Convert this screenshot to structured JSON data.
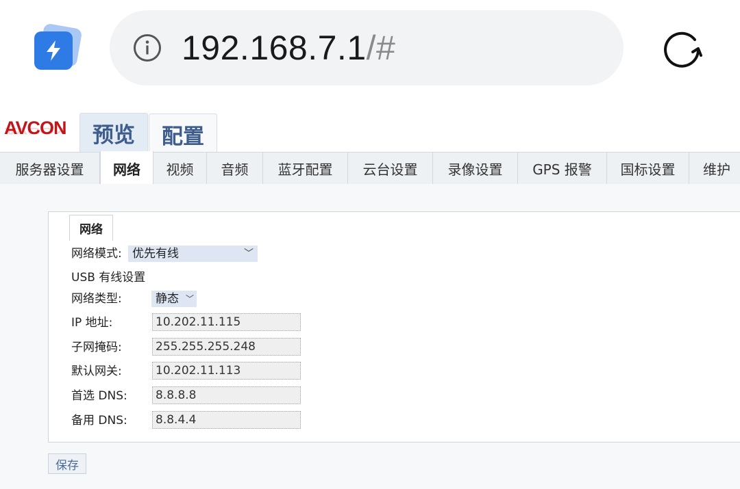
{
  "browser": {
    "url_main": "192.168.7.1",
    "url_suffix": "/#"
  },
  "logo": {
    "text": "AVCON"
  },
  "main_tabs": [
    {
      "label": "预览"
    },
    {
      "label": "配置"
    }
  ],
  "sub_tabs": [
    {
      "label": "服务器设置"
    },
    {
      "label": "网络"
    },
    {
      "label": "视频"
    },
    {
      "label": "音频"
    },
    {
      "label": "蓝牙配置"
    },
    {
      "label": "云台设置"
    },
    {
      "label": "录像设置"
    },
    {
      "label": "GPS 报警"
    },
    {
      "label": "国标设置"
    },
    {
      "label": "维护"
    }
  ],
  "panel": {
    "tab_label": "网络",
    "network_mode": {
      "label": "网络模式:",
      "value": "优先有线"
    },
    "section_title": "USB 有线设置",
    "network_type": {
      "label": "网络类型:",
      "value": "静态"
    },
    "fields": [
      {
        "label": "IP 地址:",
        "value": "10.202.11.115"
      },
      {
        "label": "子网掩码:",
        "value": "255.255.255.248"
      },
      {
        "label": "默认网关:",
        "value": "10.202.11.113"
      },
      {
        "label": "首选 DNS:",
        "value": "8.8.8.8"
      },
      {
        "label": "备用 DNS:",
        "value": "8.8.4.4"
      }
    ]
  },
  "save_label": "保存",
  "colors": {
    "brand_red": "#c0161a",
    "tab_blue_text": "#3e5c8c",
    "app_icon_blue": "#2f7be6",
    "select_bg": "#dde6f2"
  }
}
